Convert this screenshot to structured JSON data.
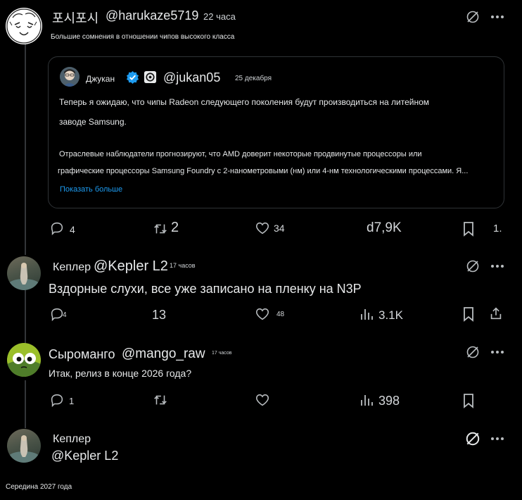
{
  "post_main": {
    "author_name": "포시포시",
    "handle": "@harukaze5719",
    "time": "22 часа",
    "subtitle": "Большие сомнения в отношении чипов высокого класса",
    "quote": {
      "author_name": "Джукан",
      "handle": "@jukan05",
      "date": "25 декабря",
      "line1": "Теперь я ожидаю, что чипы Radeon следующего поколения будут производиться на литейном",
      "line2": "заводе Samsung.",
      "line3": "Отраслевые наблюдатели прогнозируют, что AMD доверит некоторые продвинутые процессоры или",
      "line4": "графические процессоры Samsung Foundry с 2-нанометровыми (нм) или 4-нм технологическими процессами. Я...",
      "show_more": "Показать больше"
    },
    "replies": "4",
    "reposts": "2",
    "likes": "34",
    "views": "d7,9K",
    "extra": "1."
  },
  "reply_1": {
    "author_name": "Кеплер",
    "handle": "@Kepler L2",
    "time": "17 часов",
    "text": "Вздорные слухи, все уже записано на пленку на N3P",
    "replies": "4",
    "reposts": "13",
    "likes": "48",
    "views": "3.1K"
  },
  "reply_2": {
    "author_name": "Сыроманго",
    "handle": "@mango_raw",
    "time": "17 часов",
    "text": "Итак, релиз в конце 2026 года?",
    "replies": "1",
    "views": "398"
  },
  "reply_3": {
    "author_name": "Кеплер",
    "handle": "@Kepler L2",
    "text": "Середина 2027 года"
  },
  "colors": {
    "background": "#000000",
    "text": "#e7e9ea",
    "link": "#1d9bf0",
    "border": "#2f3336",
    "verified": "#1d9bf0"
  },
  "icons": [
    "grok-icon",
    "more-dots-icon",
    "reply-icon",
    "repost-icon",
    "like-icon",
    "views-icon",
    "bookmark-icon",
    "share-icon",
    "verified-badge-icon"
  ]
}
